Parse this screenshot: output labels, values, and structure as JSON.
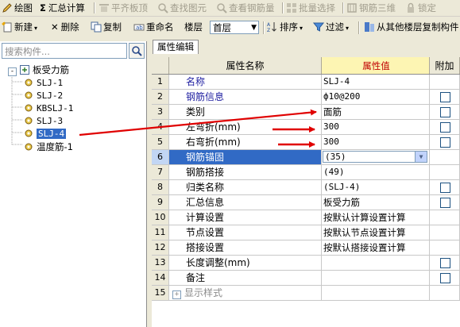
{
  "toolbar1": {
    "draw": "绘图",
    "calc": "汇总计算",
    "align_top": "平齐板顶",
    "find_element": "查找图元",
    "view_rebar": "查看钢筋量",
    "batch_select": "批量选择",
    "rebar_3d": "钢筋三维",
    "lock": "锁定"
  },
  "toolbar2": {
    "new": "新建",
    "delete": "删除",
    "copy": "复制",
    "rename": "重命名",
    "floor_label": "楼层",
    "floor_value": "首层",
    "sort": "排序",
    "filter": "过滤",
    "copy_from_floor": "从其他楼层复制构件"
  },
  "left_panel": {
    "search_placeholder": "搜索构件...",
    "root": "板受力筋",
    "children": [
      "SLJ-1",
      "SLJ-2",
      "KBSLJ-1",
      "SLJ-3",
      "SLJ-4",
      "温度筋-1"
    ],
    "selected": "SLJ-4"
  },
  "tab": "属性编辑",
  "grid": {
    "headers": {
      "name": "属性名称",
      "value": "属性值",
      "extra": "附加"
    },
    "rows": [
      {
        "num": "1",
        "name": "名称",
        "value": "SLJ-4",
        "check": false
      },
      {
        "num": "2",
        "name": "钢筋信息",
        "value": "ф10@200",
        "check": true
      },
      {
        "num": "3",
        "name": "类别",
        "value": "面筋",
        "check": true
      },
      {
        "num": "4",
        "name": "左弯折(mm)",
        "value": "300",
        "check": true
      },
      {
        "num": "5",
        "name": "右弯折(mm)",
        "value": "300",
        "check": true
      },
      {
        "num": "6",
        "name": "钢筋锚固",
        "value": "(35)",
        "check": false
      },
      {
        "num": "7",
        "name": "钢筋搭接",
        "value": "(49)",
        "check": false
      },
      {
        "num": "8",
        "name": "归类名称",
        "value": "(SLJ-4)",
        "check": true
      },
      {
        "num": "9",
        "name": "汇总信息",
        "value": "板受力筋",
        "check": true
      },
      {
        "num": "10",
        "name": "计算设置",
        "value": "按默认计算设置计算",
        "check": false
      },
      {
        "num": "11",
        "name": "节点设置",
        "value": "按默认节点设置计算",
        "check": false
      },
      {
        "num": "12",
        "name": "搭接设置",
        "value": "按默认搭接设置计算",
        "check": false
      },
      {
        "num": "13",
        "name": "长度调整(mm)",
        "value": "",
        "check": true
      },
      {
        "num": "14",
        "name": "备注",
        "value": "",
        "check": true
      },
      {
        "num": "15",
        "name": "显示样式",
        "value": "",
        "check": false
      }
    ]
  },
  "colors": {
    "selection": "#316ac5",
    "annotation_arrow": "#e00000",
    "value_header_bg": "#fdf5b3"
  }
}
